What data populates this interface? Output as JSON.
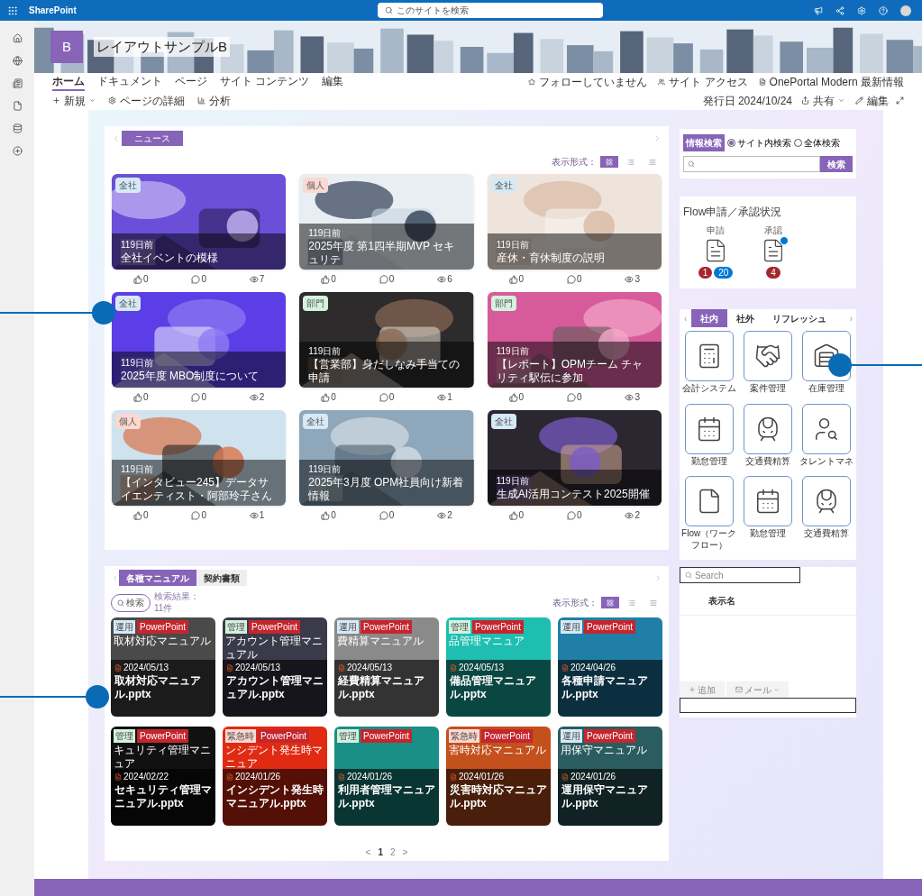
{
  "suite_bar": {
    "app": "SharePoint",
    "search_placeholder": "このサイトを検索"
  },
  "site": {
    "logo": "B",
    "title": "レイアウトサンプルB"
  },
  "nav": {
    "items": [
      {
        "label": "ホーム",
        "selected": true
      },
      {
        "label": "ドキュメント",
        "selected": false
      },
      {
        "label": "ページ",
        "selected": false
      },
      {
        "label": "サイト コンテンツ",
        "selected": false
      },
      {
        "label": "編集",
        "selected": false
      }
    ],
    "actions": [
      "フォローしていません",
      "サイト アクセス",
      "OnePortal Modern 最新情報"
    ]
  },
  "command_bar": {
    "left": [
      "新規",
      "ページの詳細",
      "分析"
    ],
    "published": "発行日 2024/10/24",
    "share": "共有",
    "edit": "編集"
  },
  "news": {
    "tab": "ニュース",
    "view_label": "表示形式：",
    "view_modes": [
      {
        "kind": "card",
        "selected": true
      },
      {
        "kind": "list",
        "selected": false
      },
      {
        "kind": "grid",
        "selected": false
      }
    ],
    "items": [
      {
        "tag": "全社",
        "color": "#d6e9f7",
        "age": "119日前",
        "title": "全社イベントの模様",
        "likes": "0",
        "comments": "0",
        "views": "7"
      },
      {
        "tag": "個人",
        "color": "#fbd8d2",
        "age": "119日前",
        "title": "2025年度 第1四半期MVP セキュリテ",
        "likes": "0",
        "comments": "0",
        "views": "6"
      },
      {
        "tag": "全社",
        "color": "#d6e9f7",
        "age": "119日前",
        "title": "産休・育休制度の説明",
        "likes": "0",
        "comments": "0",
        "views": "3"
      },
      {
        "tag": "全社",
        "color": "#d6e9f7",
        "age": "119日前",
        "title": "2025年度 MBO制度について",
        "likes": "0",
        "comments": "0",
        "views": "2"
      },
      {
        "tag": "部門",
        "color": "#d3f1dd",
        "age": "119日前",
        "title": "【営業部】身だしなみ手当ての申請",
        "likes": "0",
        "comments": "0",
        "views": "1"
      },
      {
        "tag": "部門",
        "color": "#d3f1dd",
        "age": "119日前",
        "title": "【レポート】OPMチーム チャリティ駅伝に参加",
        "likes": "0",
        "comments": "0",
        "views": "3"
      },
      {
        "tag": "個人",
        "color": "#fbd8d2",
        "age": "119日前",
        "title": "【インタビュー245】データサイエンティスト・阿部玲子さん",
        "likes": "0",
        "comments": "0",
        "views": "1"
      },
      {
        "tag": "全社",
        "color": "#d6e9f7",
        "age": "119日前",
        "title": "2025年3月度 OPM社員向け新着情報",
        "likes": "0",
        "comments": "0",
        "views": "2"
      },
      {
        "tag": "全社",
        "color": "#d6e9f7",
        "age": "119日前",
        "title": "生成AI活用コンテスト2025開催",
        "likes": "0",
        "comments": "0",
        "views": "2"
      }
    ]
  },
  "manuals": {
    "tabs": [
      {
        "label": "各種マニュアル",
        "selected": true
      },
      {
        "label": "契約書類",
        "selected": false
      }
    ],
    "search_button": "検索",
    "result_label": "検索結果：",
    "result_count": "11件",
    "view_label": "表示形式：",
    "view_modes": [
      {
        "kind": "card",
        "selected": true
      },
      {
        "kind": "list",
        "selected": false
      },
      {
        "kind": "grid",
        "selected": false
      }
    ],
    "items": [
      {
        "category": "運用",
        "color": "#d6e9f7",
        "app": "PowerPoint",
        "slide_text": "取材対応マニュアル",
        "date": "2024/05/13",
        "filename": "取材対応マニュアル.pptx"
      },
      {
        "category": "管理",
        "color": "#d3f1dd",
        "app": "PowerPoint",
        "slide_text": "アカウント管理マニュアル",
        "date": "2024/05/13",
        "filename": "アカウント管理マニュアル.pptx"
      },
      {
        "category": "運用",
        "color": "#d6e9f7",
        "app": "PowerPoint",
        "slide_text": "費精算マニュアル",
        "date": "2024/05/13",
        "filename": "経費精算マニュアル.pptx"
      },
      {
        "category": "管理",
        "color": "#d3f1dd",
        "app": "PowerPoint",
        "slide_text": "品管理マニュア",
        "date": "2024/05/13",
        "filename": "備品管理マニュアル.pptx"
      },
      {
        "category": "運用",
        "color": "#d6e9f7",
        "app": "PowerPoint",
        "date": "2024/04/26",
        "filename": "各種申請マニュアル.pptx"
      },
      {
        "category": "管理",
        "color": "#d3f1dd",
        "app": "PowerPoint",
        "slide_text": "キュリティ管理マニュア",
        "date": "2024/02/22",
        "filename": "セキュリティ管理マニュアル.pptx"
      },
      {
        "category": "緊急時",
        "color": "#fbd8d2",
        "app": "PowerPoint",
        "slide_text": "ンシデント発生時マニュア",
        "date": "2024/01/26",
        "filename": "インシデント発生時マニュアル.pptx"
      },
      {
        "category": "管理",
        "color": "#d3f1dd",
        "app": "PowerPoint",
        "date": "2024/01/26",
        "filename": "利用者管理マニュアル.pptx"
      },
      {
        "category": "緊急時",
        "color": "#fbd8d2",
        "app": "PowerPoint",
        "slide_text": "害時対応マニュアル",
        "date": "2024/01/26",
        "filename": "災害時対応マニュアル.pptx"
      },
      {
        "category": "運用",
        "color": "#d6e9f7",
        "app": "PowerPoint",
        "slide_text": "用保守マニュアル",
        "date": "2024/01/26",
        "filename": "運用保守マニュアル.pptx"
      }
    ],
    "pagination": {
      "prev": "<",
      "pages": [
        {
          "label": "1",
          "selected": true
        },
        {
          "label": "2",
          "selected": false
        }
      ],
      "next": ">"
    }
  },
  "info_search": {
    "label": "情報検索",
    "options": [
      {
        "label": "サイト内検索",
        "selected": true
      },
      {
        "label": "全体検索",
        "selected": false
      }
    ],
    "button": "検索"
  },
  "flow_status": {
    "title": "Flow申請／承認状況",
    "columns": [
      {
        "label": "申請",
        "alert": false,
        "badges": [
          {
            "text": "1",
            "color": "#a4262c"
          },
          {
            "text": "20",
            "color": "#0078d4"
          }
        ]
      },
      {
        "label": "承認",
        "alert": true,
        "badges": [
          {
            "text": "4",
            "color": "#a4262c"
          }
        ]
      }
    ]
  },
  "links": {
    "prev": "‹",
    "next": "›",
    "tabs": [
      {
        "label": "社内",
        "selected": true
      },
      {
        "label": "社外",
        "selected": false
      },
      {
        "label": "リフレッシュ",
        "selected": false
      }
    ],
    "tiles": [
      {
        "kind": "accounting",
        "label": "会計システム"
      },
      {
        "kind": "deal",
        "label": "案件管理"
      },
      {
        "kind": "warehouse",
        "label": "在庫管理"
      },
      {
        "kind": "calendar",
        "label": "勤怠管理"
      },
      {
        "kind": "train",
        "label": "交通費精算"
      },
      {
        "kind": "talent",
        "label": "タレントマネ"
      },
      {
        "kind": "flow",
        "label": "Flow（ワークフロー）"
      },
      {
        "kind": "calendar",
        "label": "勤怠管理"
      },
      {
        "kind": "train",
        "label": "交通費精算"
      }
    ]
  },
  "people_list": {
    "search_placeholder": "Search",
    "column": "表示名",
    "buttons": [
      "追加",
      "メール"
    ]
  }
}
